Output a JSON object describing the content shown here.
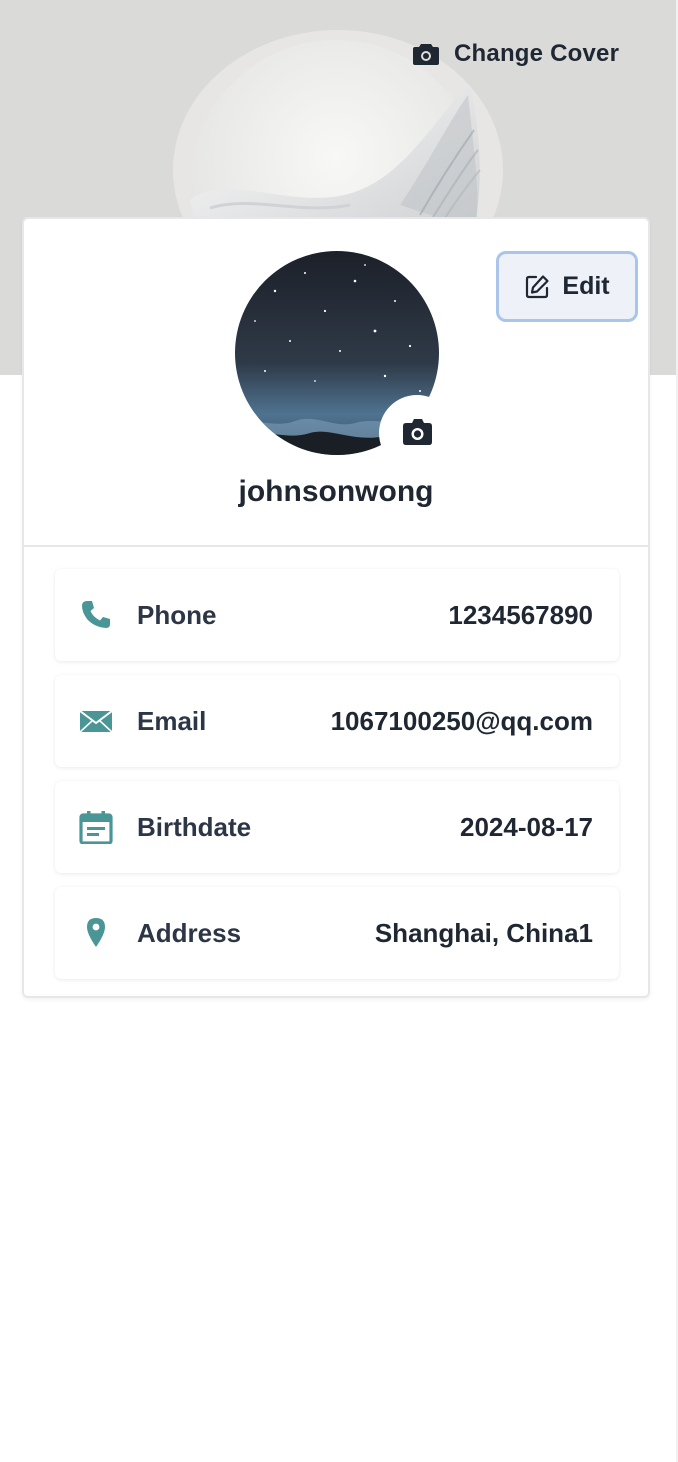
{
  "cover": {
    "change_cover_label": "Change Cover",
    "icon": "camera-icon"
  },
  "profile": {
    "edit_label": "Edit",
    "edit_icon": "pencil-square-icon",
    "avatar_icon": "camera-icon",
    "username": "johnsonwong"
  },
  "info": [
    {
      "icon": "phone-icon",
      "label": "Phone",
      "value": "1234567890"
    },
    {
      "icon": "mail-icon",
      "label": "Email",
      "value": "1067100250@qq.com"
    },
    {
      "icon": "calendar-icon",
      "label": "Birthdate",
      "value": "2024-08-17"
    },
    {
      "icon": "location-pin-icon",
      "label": "Address",
      "value": "Shanghai, China1"
    }
  ],
  "colors": {
    "accent_teal": "#4a9696",
    "text_dark": "#1f2733",
    "edit_border": "#a9c6ea"
  }
}
